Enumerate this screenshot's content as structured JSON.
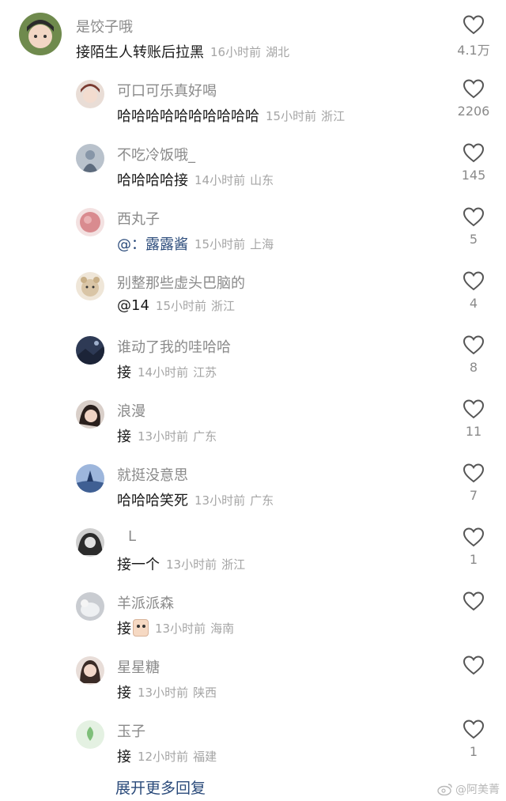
{
  "comments": [
    {
      "user": "是饺子哦",
      "text": "接陌生人转账后拉黑",
      "time": "16小时前",
      "location": "湖北",
      "likes": "4.1万",
      "avatar_color": "#6f8a4d"
    },
    {
      "user": "可口可乐真好喝",
      "text": "哈哈哈哈哈哈哈哈哈哈",
      "time": "15小时前",
      "location": "浙江",
      "likes": "2206",
      "avatar_color": "#c7a79a"
    },
    {
      "user": "不吃冷饭哦_",
      "text": "哈哈哈哈接",
      "time": "14小时前",
      "location": "山东",
      "likes": "145",
      "avatar_color": "#8796a8"
    },
    {
      "user": "西丸子",
      "text": "@：露露酱",
      "time": "15小时前",
      "location": "上海",
      "likes": "5",
      "avatar_color": "#d98b8f"
    },
    {
      "user": "别整那些虚头巴脑的",
      "text": "@14",
      "time": "15小时前",
      "location": "浙江",
      "likes": "4",
      "avatar_color": "#d9c5a6"
    },
    {
      "user": "谁动了我的哇哈哈",
      "text": "接",
      "time": "14小时前",
      "location": "江苏",
      "likes": "8",
      "avatar_color": "#2e3a55"
    },
    {
      "user": "浪漫",
      "text": "接",
      "time": "13小时前",
      "location": "广东",
      "likes": "11",
      "avatar_color": "#4a3a36"
    },
    {
      "user": "就挺没意思",
      "text": "哈哈哈笑死",
      "time": "13小时前",
      "location": "广东",
      "likes": "7",
      "avatar_color": "#6f8fbf"
    },
    {
      "user": "L",
      "text": "接一个",
      "time": "13小时前",
      "location": "浙江",
      "likes": "1",
      "avatar_color": "#3a3a3a"
    },
    {
      "user": "羊派派森",
      "text": "接",
      "time": "13小时前",
      "location": "海南",
      "likes": "",
      "avatar_color": "#9a9ea3"
    },
    {
      "user": "星星糖",
      "text": "接",
      "time": "13小时前",
      "location": "陕西",
      "likes": "",
      "avatar_color": "#5a4640"
    },
    {
      "user": "玉子",
      "text": "接",
      "time": "12小时前",
      "location": "福建",
      "likes": "1",
      "avatar_color": "#e4f1e2"
    }
  ],
  "expand_more": "展开更多回复",
  "watermark": "@阿美菁",
  "colors": {
    "link": "#2a4a7a",
    "username": "#8a8a8a",
    "meta": "#a5a5a5"
  }
}
